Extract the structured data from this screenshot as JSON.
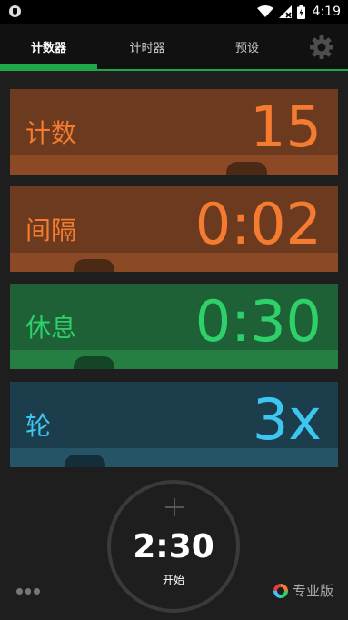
{
  "status_bar": {
    "time": "4:19"
  },
  "tabs": [
    {
      "label": "计数器",
      "active": true
    },
    {
      "label": "计时器",
      "active": false
    },
    {
      "label": "预设",
      "active": false
    }
  ],
  "cards": {
    "count": {
      "label": "计数",
      "value": "15"
    },
    "interval": {
      "label": "间隔",
      "value": "0:02"
    },
    "rest": {
      "label": "休息",
      "value": "0:30"
    },
    "rounds": {
      "label": "轮",
      "value": "3x"
    }
  },
  "start": {
    "total_time": "2:30",
    "label": "开始"
  },
  "pro": {
    "label": "专业版"
  },
  "colors": {
    "accent": "#1fa84a",
    "count": "#f47b30",
    "rest": "#2ed06a",
    "rounds": "#3ec6f2"
  }
}
